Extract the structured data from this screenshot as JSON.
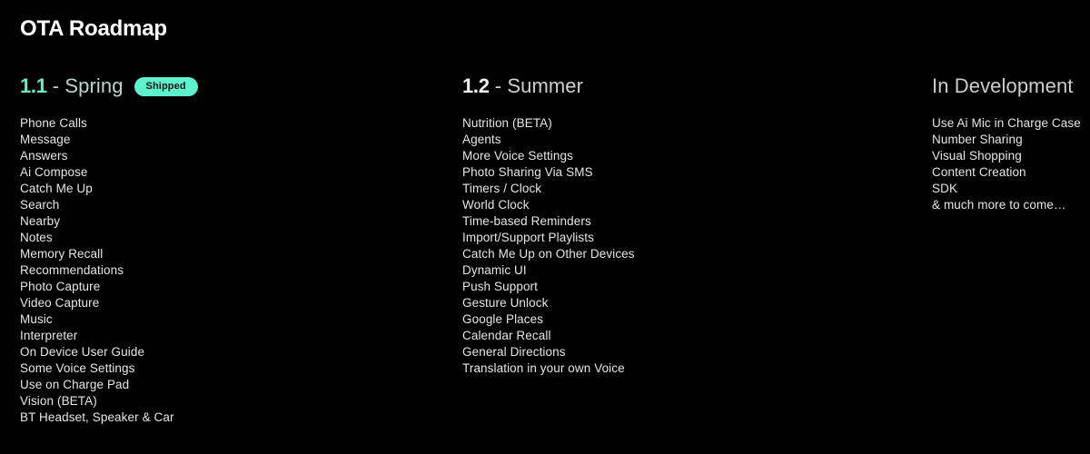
{
  "page": {
    "title": "OTA Roadmap",
    "background_color": "#000000",
    "accent_color": "#5ef2cd",
    "text_color": "#e6e6e6"
  },
  "columns": [
    {
      "version": "1.1",
      "separator": "-",
      "season": "Spring",
      "badge": "Shipped",
      "items": [
        "Phone Calls",
        "Message",
        "Answers",
        "Ai Compose",
        "Catch Me Up",
        "Search",
        "Nearby",
        "Notes",
        "Memory Recall",
        "Recommendations",
        "Photo Capture",
        "Video Capture",
        "Music",
        "Interpreter",
        "On Device User Guide",
        "Some Voice Settings",
        "Use on Charge Pad",
        "Vision (BETA)",
        "BT Headset, Speaker & Car"
      ]
    },
    {
      "version": "1.2",
      "separator": "-",
      "season": "Summer",
      "items": [
        "Nutrition (BETA)",
        "Agents",
        "More Voice Settings",
        "Photo Sharing Via SMS",
        "Timers / Clock",
        "World Clock",
        "Time-based Reminders",
        "Import/Support Playlists",
        "Catch Me Up on Other Devices",
        "Dynamic UI",
        "Push Support",
        "Gesture Unlock",
        "Google Places",
        "Calendar Recall",
        "General Directions",
        "Translation in your own Voice"
      ]
    },
    {
      "heading": "In Development",
      "items": [
        "Use Ai Mic in Charge Case",
        "Number Sharing",
        "Visual Shopping",
        "Content Creation",
        "SDK",
        "& much more to come…"
      ]
    }
  ]
}
